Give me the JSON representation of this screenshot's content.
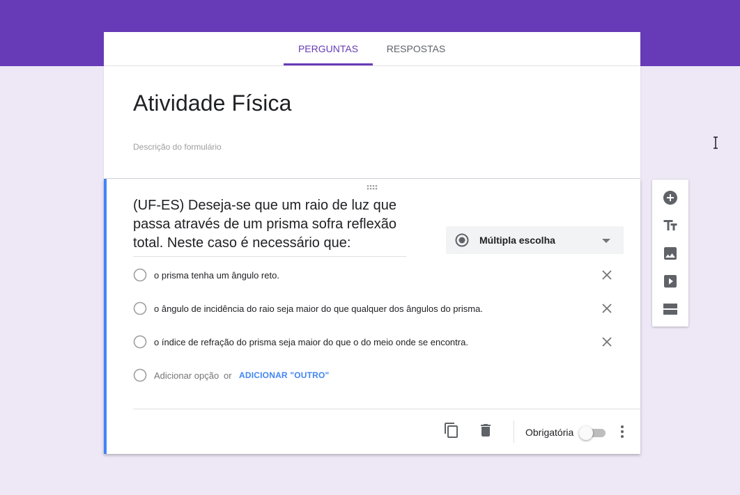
{
  "tabs": [
    {
      "label": "PERGUNTAS",
      "active": true
    },
    {
      "label": "RESPOSTAS",
      "active": false
    }
  ],
  "form": {
    "title": "Atividade Física",
    "description_placeholder": "Descrição do formulário"
  },
  "question": {
    "text": "(UF-ES) Deseja-se que um raio de luz que passa através de um prisma sofra reflexão total. Neste caso é necessário que:",
    "type_label": "Múltipla escolha",
    "options": [
      {
        "label": "o prisma tenha um ângulo reto."
      },
      {
        "label": "o ângulo de incidência do raio seja maior do que qualquer dos ângulos do prisma."
      },
      {
        "label": "o índice de refração do prisma seja maior do que o do meio onde se encontra."
      }
    ],
    "add_option_label": "Adicionar opção",
    "or_label": "or",
    "add_other_label": "ADICIONAR \"OUTRO\"",
    "required_label": "Obrigatória",
    "required": false
  },
  "colors": {
    "primary": "#673ab7",
    "background": "#ede7f6",
    "accent_blue": "#4285f4"
  },
  "icons": {
    "toolbar": [
      "add-circle-icon",
      "title-icon",
      "image-icon",
      "video-icon",
      "section-icon"
    ],
    "footer": [
      "copy-icon",
      "delete-icon",
      "more-vert-icon"
    ]
  }
}
